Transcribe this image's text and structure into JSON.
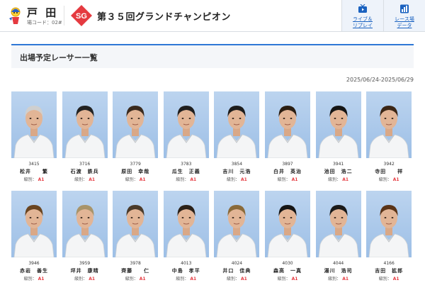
{
  "header": {
    "venue": "戸 田",
    "venue_code": "場コード：02#",
    "grade": "SG",
    "event_title": "第３５回グランドチャンピオン",
    "buttons": [
      {
        "label_line1": "ライブ＆",
        "label_line2": "リプレイ",
        "icon": "tv-icon"
      },
      {
        "label_line1": "レース場",
        "label_line2": "データ",
        "icon": "chart-icon"
      }
    ]
  },
  "section": {
    "title": "出場予定レーサー一覧",
    "date_range": "2025/06/24-2025/06/29"
  },
  "grade_label": "級別：",
  "racers": [
    {
      "number": "3415",
      "name": "松井　　繁",
      "grade": "A1",
      "hair": "#cfcfcf"
    },
    {
      "number": "3716",
      "name": "石渡　鉄兵",
      "grade": "A1",
      "hair": "#222222"
    },
    {
      "number": "3779",
      "name": "原田　幸哉",
      "grade": "A1",
      "hair": "#3a2a1e"
    },
    {
      "number": "3783",
      "name": "瓜生　正義",
      "grade": "A1",
      "hair": "#1e1e1e"
    },
    {
      "number": "3854",
      "name": "吉川　元浩",
      "grade": "A1",
      "hair": "#1c1c1c"
    },
    {
      "number": "3897",
      "name": "白井　英治",
      "grade": "A1",
      "hair": "#2a1d12"
    },
    {
      "number": "3941",
      "name": "池田　浩二",
      "grade": "A1",
      "hair": "#151515"
    },
    {
      "number": "3942",
      "name": "寺田　　祥",
      "grade": "A1",
      "hair": "#3b2616"
    },
    {
      "number": "3946",
      "name": "赤岩　善生",
      "grade": "A1",
      "hair": "#6a4520"
    },
    {
      "number": "3959",
      "name": "坪井　康晴",
      "grade": "A1",
      "hair": "#a8946a"
    },
    {
      "number": "3978",
      "name": "齊藤　　仁",
      "grade": "A1",
      "hair": "#4a3a2a"
    },
    {
      "number": "4013",
      "name": "中島　孝平",
      "grade": "A1",
      "hair": "#2a2018"
    },
    {
      "number": "4024",
      "name": "井口　佳典",
      "grade": "A1",
      "hair": "#8a6a3a"
    },
    {
      "number": "4030",
      "name": "森高　一真",
      "grade": "A1",
      "hair": "#151515"
    },
    {
      "number": "4044",
      "name": "湯川　浩司",
      "grade": "A1",
      "hair": "#1a1a1a"
    },
    {
      "number": "4166",
      "name": "吉田　拡郎",
      "grade": "A1",
      "hair": "#5a3418"
    }
  ]
}
